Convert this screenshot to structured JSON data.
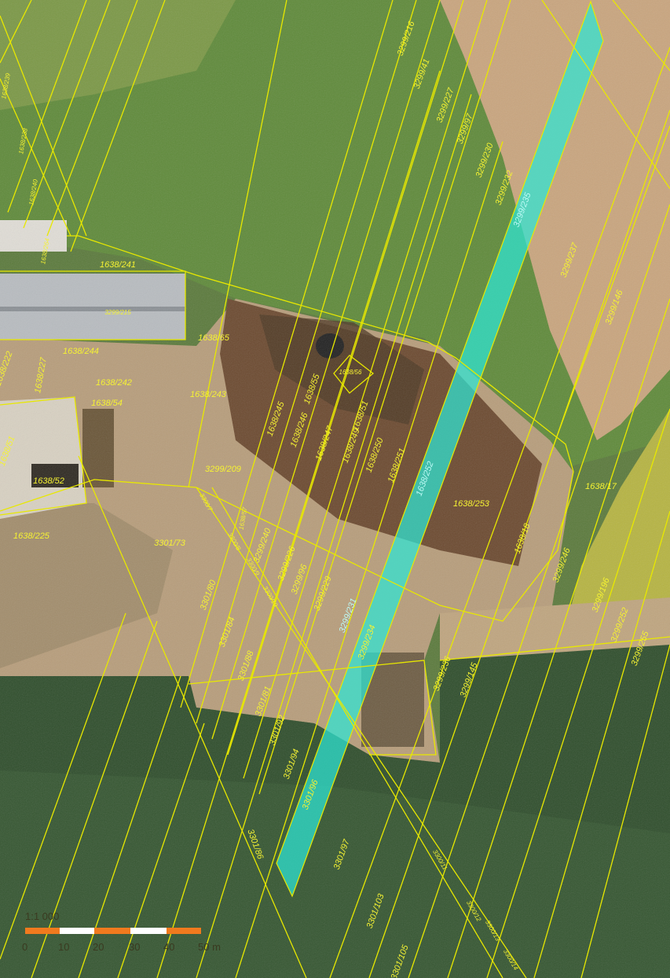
{
  "map": {
    "scale_ratio": "1:1 000",
    "scale_ticks": [
      "0",
      "10",
      "20",
      "30",
      "40",
      "50 m"
    ],
    "colors": {
      "parcel_line": "#e8e800",
      "parcel_label": "#f5f233",
      "highlight_fill": "#2ee6d6",
      "scale_orange": "#f07a1e",
      "scale_white": "#ffffff"
    },
    "parcels": [
      "3299/216",
      "3299/41",
      "3299/227",
      "3299/97",
      "3299/230",
      "3299/232",
      "3299/235",
      "3299/237",
      "3299/146",
      "1638/241",
      "1638/65",
      "1638/244",
      "1638/227",
      "1638/242",
      "1638/54",
      "1638/243",
      "1638/55",
      "1638/56",
      "1638/245",
      "1638/246",
      "1638/247",
      "1638/249",
      "1638/51",
      "1638/250",
      "1638/251",
      "1638/252",
      "1638/253",
      "1638/17",
      "1638/18",
      "1638/52",
      "1638/225",
      "1638/51",
      "1638/222",
      "3299/209",
      "3301/73",
      "3299/240",
      "3299/226",
      "3299/96",
      "3299/229",
      "3299/231",
      "3299/234",
      "3299/236",
      "3299/145",
      "3299/196",
      "3299/252",
      "3299/246",
      "3299/255",
      "3301/80",
      "3301/84",
      "3301/88",
      "3301/81",
      "3301/92",
      "3301/94",
      "3301/96",
      "3301/86",
      "3301/97",
      "3301/103",
      "3301/105",
      "3300/11",
      "3300/7",
      "3300/8",
      "3300/9",
      "3300/10",
      "3300/12",
      "3300/13",
      "3300/14",
      "1638/239",
      "1638/238",
      "1638/240",
      "1638/264",
      "3299/215",
      "1638/57"
    ]
  }
}
